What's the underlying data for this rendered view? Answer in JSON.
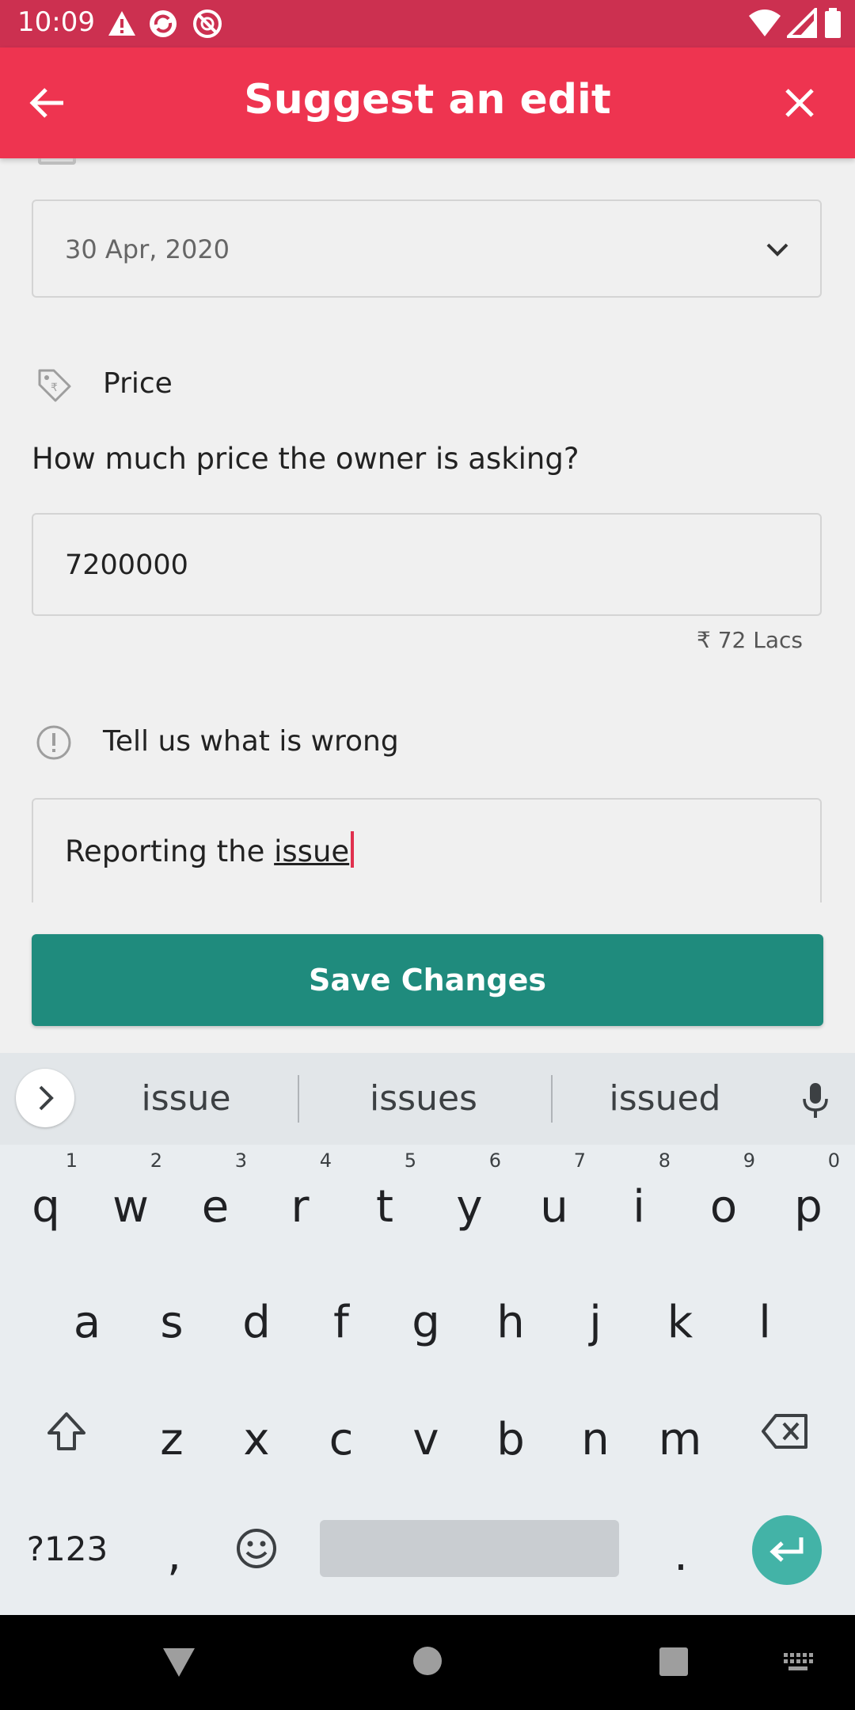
{
  "status_bar": {
    "time": "10:09"
  },
  "app_bar": {
    "title": "Suggest an edit"
  },
  "form": {
    "date_value": "30 Apr, 2020",
    "price_section": {
      "label": "Price",
      "question": "How much price the owner is asking?",
      "value": "7200000",
      "in_words": "₹ 72  Lacs"
    },
    "issue_section": {
      "label": "Tell us what is wrong",
      "text_prefix": "Reporting the ",
      "text_underlined": "issue"
    },
    "save_button": "Save Changes"
  },
  "keyboard": {
    "suggestions": [
      "issue",
      "issues",
      "issued"
    ],
    "row1": [
      {
        "key": "q",
        "hint": "1"
      },
      {
        "key": "w",
        "hint": "2"
      },
      {
        "key": "e",
        "hint": "3"
      },
      {
        "key": "r",
        "hint": "4"
      },
      {
        "key": "t",
        "hint": "5"
      },
      {
        "key": "y",
        "hint": "6"
      },
      {
        "key": "u",
        "hint": "7"
      },
      {
        "key": "i",
        "hint": "8"
      },
      {
        "key": "o",
        "hint": "9"
      },
      {
        "key": "p",
        "hint": "0"
      }
    ],
    "row2": [
      "a",
      "s",
      "d",
      "f",
      "g",
      "h",
      "j",
      "k",
      "l"
    ],
    "row3": [
      "z",
      "x",
      "c",
      "v",
      "b",
      "n",
      "m"
    ],
    "symbols_key": "?123",
    "comma_key": ",",
    "period_key": "."
  },
  "colors": {
    "status_bar": "#cc3050",
    "app_bar": "#ee3450",
    "save_button": "#1f8b7d",
    "enter_key": "#43b3a7"
  }
}
